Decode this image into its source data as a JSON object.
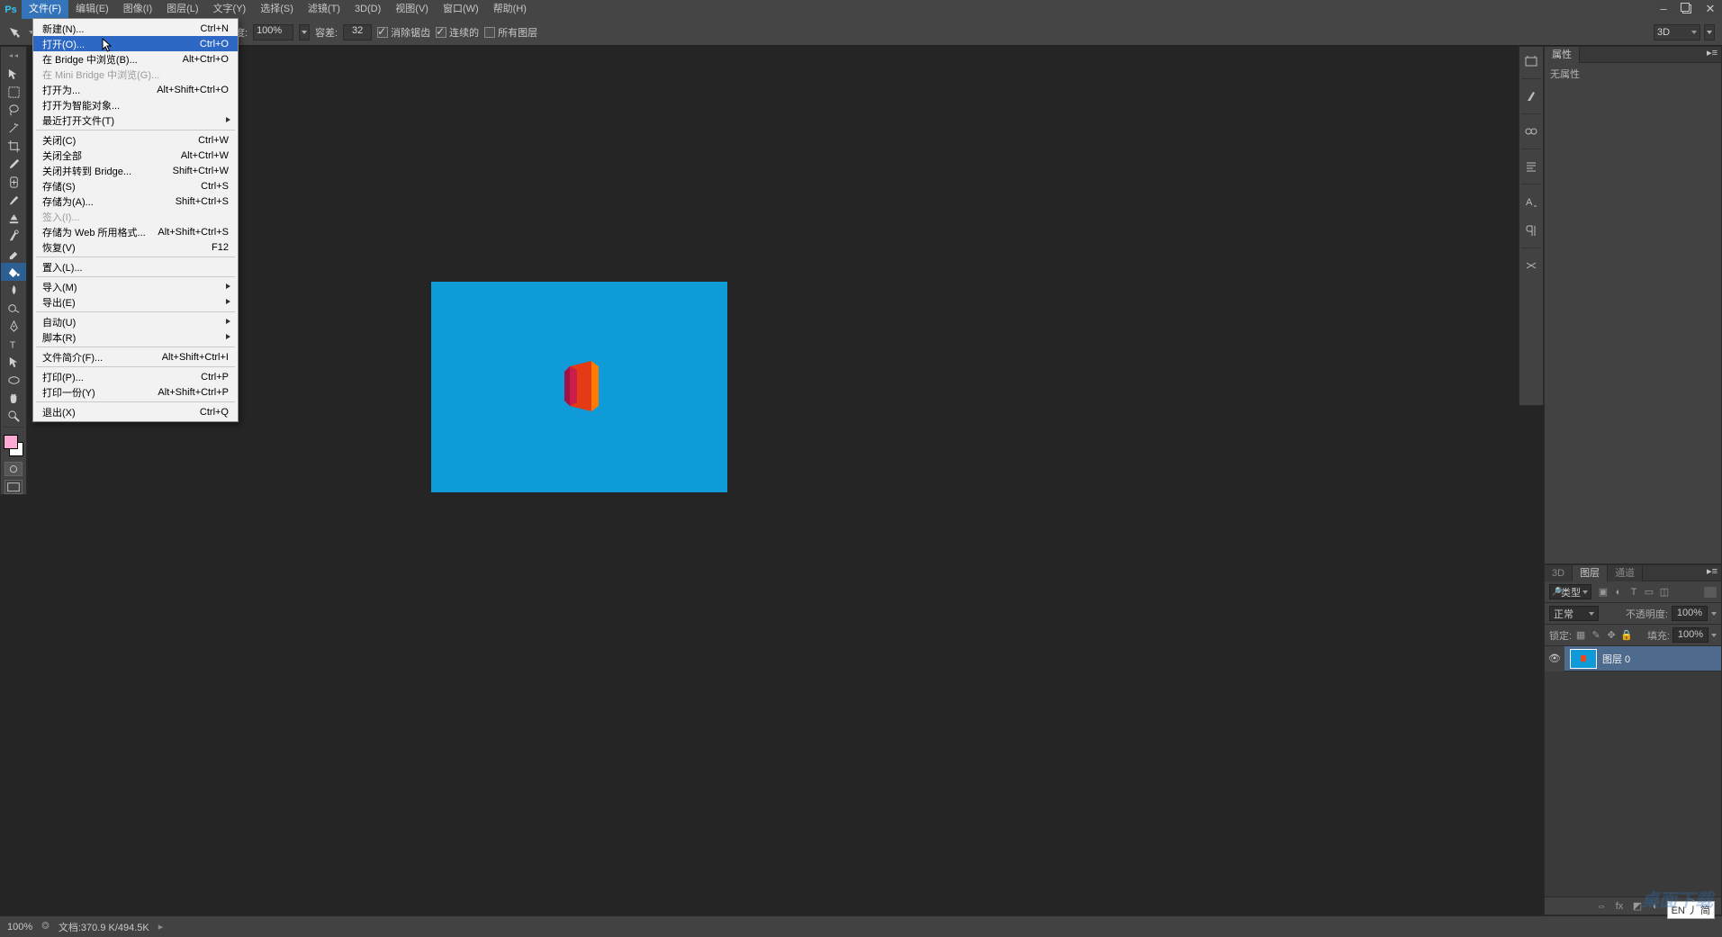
{
  "app": {
    "logo_text": "Ps",
    "window_controls": {
      "minimize": "–",
      "close": "✕"
    }
  },
  "menubar": {
    "items": [
      "文件(F)",
      "编辑(E)",
      "图像(I)",
      "图层(L)",
      "文字(Y)",
      "选择(S)",
      "滤镜(T)",
      "3D(D)",
      "视图(V)",
      "窗口(W)",
      "帮助(H)"
    ]
  },
  "options": {
    "opacity_label": "明度:",
    "opacity_value": "100%",
    "tolerance_label": "容差:",
    "tolerance_value": "32",
    "antialias_label": "消除锯齿",
    "contiguous_label": "连续的",
    "all_layers_label": "所有图层",
    "mode_3d": "3D"
  },
  "file_menu": {
    "items": [
      {
        "label": "新建(N)...",
        "shortcut": "Ctrl+N"
      },
      {
        "label": "打开(O)...",
        "shortcut": "Ctrl+O",
        "hover": true
      },
      {
        "label": "在 Bridge 中浏览(B)...",
        "shortcut": "Alt+Ctrl+O"
      },
      {
        "label": "在 Mini Bridge 中浏览(G)...",
        "shortcut": "",
        "disabled": true
      },
      {
        "label": "打开为...",
        "shortcut": "Alt+Shift+Ctrl+O"
      },
      {
        "label": "打开为智能对象...",
        "shortcut": ""
      },
      {
        "label": "最近打开文件(T)",
        "shortcut": "",
        "submenu": true
      },
      {
        "sep": true
      },
      {
        "label": "关闭(C)",
        "shortcut": "Ctrl+W"
      },
      {
        "label": "关闭全部",
        "shortcut": "Alt+Ctrl+W"
      },
      {
        "label": "关闭并转到 Bridge...",
        "shortcut": "Shift+Ctrl+W"
      },
      {
        "label": "存储(S)",
        "shortcut": "Ctrl+S"
      },
      {
        "label": "存储为(A)...",
        "shortcut": "Shift+Ctrl+S"
      },
      {
        "label": "签入(I)...",
        "shortcut": "",
        "disabled": true
      },
      {
        "label": "存储为 Web 所用格式...",
        "shortcut": "Alt+Shift+Ctrl+S"
      },
      {
        "label": "恢复(V)",
        "shortcut": "F12"
      },
      {
        "sep": true
      },
      {
        "label": "置入(L)...",
        "shortcut": ""
      },
      {
        "sep": true
      },
      {
        "label": "导入(M)",
        "shortcut": "",
        "submenu": true
      },
      {
        "label": "导出(E)",
        "shortcut": "",
        "submenu": true
      },
      {
        "sep": true
      },
      {
        "label": "自动(U)",
        "shortcut": "",
        "submenu": true
      },
      {
        "label": "脚本(R)",
        "shortcut": "",
        "submenu": true
      },
      {
        "sep": true
      },
      {
        "label": "文件简介(F)...",
        "shortcut": "Alt+Shift+Ctrl+I"
      },
      {
        "sep": true
      },
      {
        "label": "打印(P)...",
        "shortcut": "Ctrl+P"
      },
      {
        "label": "打印一份(Y)",
        "shortcut": "Alt+Shift+Ctrl+P"
      },
      {
        "sep": true
      },
      {
        "label": "退出(X)",
        "shortcut": "Ctrl+Q"
      }
    ]
  },
  "properties_panel": {
    "tab": "属性",
    "body_text": "无属性"
  },
  "layers_panel": {
    "tabs": [
      "3D",
      "图层",
      "通道"
    ],
    "filter_type": "类型",
    "blend_mode": "正常",
    "opacity_label": "不透明度:",
    "opacity_value": "100%",
    "lock_label": "锁定:",
    "fill_label": "填充:",
    "fill_value": "100%",
    "layer0_name": "图层 0"
  },
  "statusbar": {
    "zoom": "100%",
    "doc_info": "文档:370.9 K/494.5K",
    "ime": "EN 丿 简"
  },
  "watermark": "桌面下载"
}
